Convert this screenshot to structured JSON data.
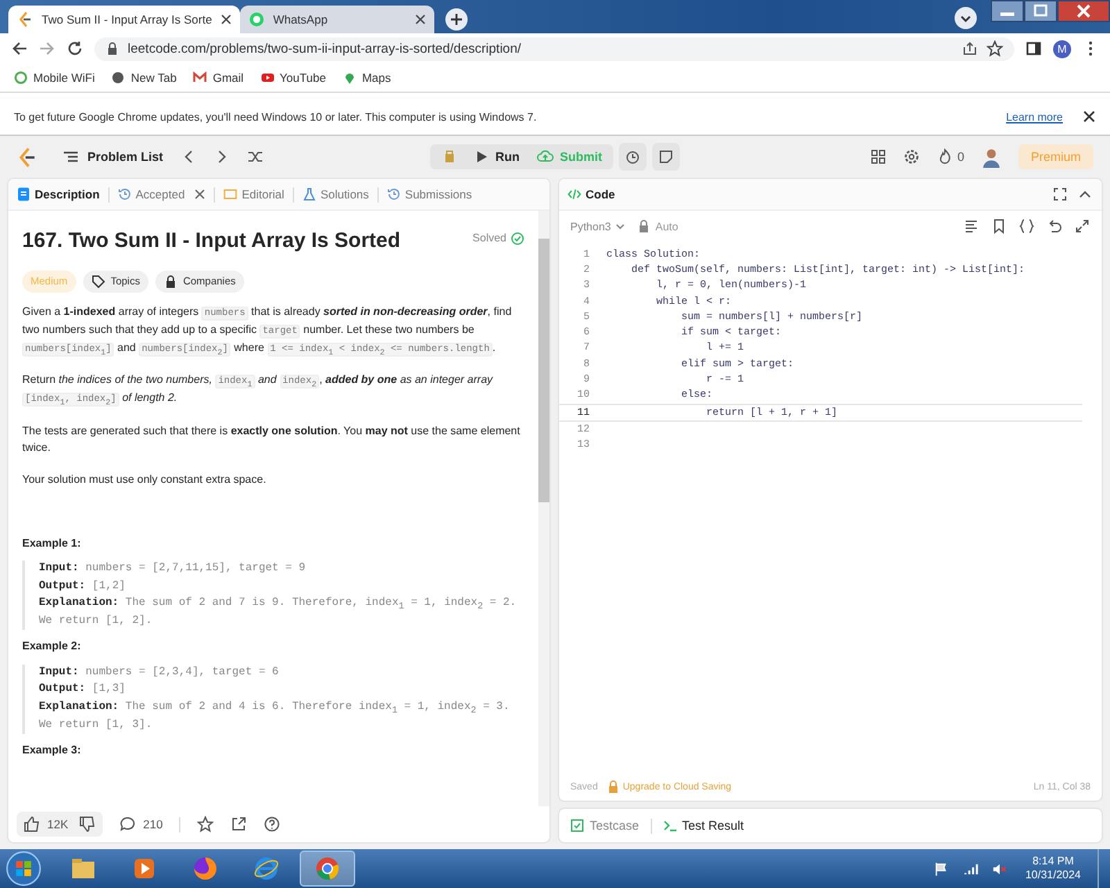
{
  "browser": {
    "tabs": [
      {
        "title": "Two Sum II - Input Array Is Sorte",
        "kind": "leetcode",
        "selected": true
      },
      {
        "title": "WhatsApp",
        "kind": "whatsapp",
        "selected": false
      }
    ],
    "url": "leetcode.com/problems/two-sum-ii-input-array-is-sorted/description/",
    "profile_initial": "M",
    "bookmarks": [
      {
        "label": "Mobile WiFi",
        "kind": "wifi"
      },
      {
        "label": "New Tab",
        "kind": "globe"
      },
      {
        "label": "Gmail",
        "kind": "gmail"
      },
      {
        "label": "YouTube",
        "kind": "youtube"
      },
      {
        "label": "Maps",
        "kind": "maps"
      }
    ]
  },
  "infobar": {
    "message": "To get future Google Chrome updates, you'll need Windows 10 or later. This computer is using Windows 7.",
    "link": "Learn more"
  },
  "header": {
    "problem_list": "Problem List",
    "run": "Run",
    "submit": "Submit",
    "streak": "0",
    "premium": "Premium"
  },
  "description_tabs": [
    {
      "label": "Description",
      "kind": "doc",
      "selected": true,
      "closable": false
    },
    {
      "label": "Accepted",
      "kind": "history",
      "selected": false,
      "closable": true
    },
    {
      "label": "Editorial",
      "kind": "book",
      "selected": false,
      "closable": false
    },
    {
      "label": "Solutions",
      "kind": "flask",
      "selected": false,
      "closable": false
    },
    {
      "label": "Submissions",
      "kind": "history",
      "selected": false,
      "closable": false
    }
  ],
  "problem": {
    "title": "167. Two Sum II - Input Array Is Sorted",
    "status": "Solved",
    "difficulty": "Medium",
    "topics": "Topics",
    "companies": "Companies",
    "paragraphs": [
      [
        {
          "kind": "text",
          "text": "Given a **1-indexed** array of integers "
        },
        {
          "kind": "code",
          "text": "numbers"
        },
        {
          "kind": "text",
          "text": " that is already "
        },
        {
          "kind": "strong-em",
          "text": "sorted in non-decreasing order"
        },
        {
          "kind": "text",
          "text": ", find two numbers such that they add up to a specific "
        },
        {
          "kind": "code",
          "text": "target"
        },
        {
          "kind": "text",
          "text": " number. Let these two numbers be "
        },
        {
          "kind": "code",
          "text": "numbers[index$_{1}$]"
        },
        {
          "kind": "text",
          "text": " and "
        },
        {
          "kind": "code",
          "text": "numbers[index$_{2}$]"
        },
        {
          "kind": "text",
          "text": " where "
        },
        {
          "kind": "code",
          "text": "1 <= index$_{1}$ < index$_{2}$ <= numbers.length"
        },
        {
          "kind": "text",
          "text": "."
        }
      ],
      [
        {
          "kind": "text",
          "text": "Return *the indices of the two numbers,* "
        },
        {
          "kind": "code",
          "text": "index$_{1}$"
        },
        {
          "kind": "text",
          "text": " *and* "
        },
        {
          "kind": "code",
          "text": "index$_{2}$"
        },
        {
          "kind": "text",
          "text": ", "
        },
        {
          "kind": "strong-em",
          "text": "added by one"
        },
        {
          "kind": "text",
          "text": " *as an integer array* "
        },
        {
          "kind": "code",
          "text": "[index$_{1}$, index$_{2}$]"
        },
        {
          "kind": "text",
          "text": " *of length 2.*"
        }
      ],
      [
        {
          "kind": "text",
          "text": "The tests are generated such that there is **exactly one solution**. You **may not** use the same element twice."
        }
      ],
      [
        {
          "kind": "text",
          "text": "Your solution must use only constant extra space."
        }
      ]
    ],
    "examples": [
      {
        "title": "Example 1:",
        "lines": [
          {
            "label": "Input:",
            "value": "numbers = [2,7,11,15], target = 9"
          },
          {
            "label": "Output:",
            "value": "[1,2]"
          },
          {
            "label": "Explanation:",
            "value": "The sum of 2 and 7 is 9. Therefore, index$_{1}$ = 1, index$_{2}$ = 2. We return [1, 2]."
          }
        ]
      },
      {
        "title": "Example 2:",
        "lines": [
          {
            "label": "Input:",
            "value": "numbers = [2,3,4], target = 6"
          },
          {
            "label": "Output:",
            "value": "[1,3]"
          },
          {
            "label": "Explanation:",
            "value": "The sum of 2 and 4 is 6. Therefore index$_{1}$ = 1, index$_{2}$ = 3. We return [1, 3]."
          }
        ]
      },
      {
        "title": "Example 3:"
      }
    ]
  },
  "left_footer": {
    "likes": "12K",
    "comments": "210"
  },
  "code_panel": {
    "title": "Code",
    "language": "Python3",
    "mode": "Auto",
    "lines": [
      {
        "number": "1",
        "text": "class Solution:",
        "current": false
      },
      {
        "number": "2",
        "text": "    def twoSum(self, numbers: List[int], target: int) -> List[int]:",
        "current": false
      },
      {
        "number": "3",
        "text": "        l, r = 0, len(numbers)-1",
        "current": false
      },
      {
        "number": "4",
        "text": "        while l < r:",
        "current": false
      },
      {
        "number": "5",
        "text": "            sum = numbers[l] + numbers[r]",
        "current": false
      },
      {
        "number": "6",
        "text": "            if sum < target:",
        "current": false
      },
      {
        "number": "7",
        "text": "                l += 1",
        "current": false
      },
      {
        "number": "8",
        "text": "            elif sum > target:",
        "current": false
      },
      {
        "number": "9",
        "text": "                r -= 1",
        "current": false
      },
      {
        "number": "10",
        "text": "            else:",
        "current": false
      },
      {
        "number": "11",
        "text": "                return [l + 1, r + 1]",
        "current": true
      },
      {
        "number": "12",
        "current": false
      },
      {
        "number": "13",
        "current": false
      }
    ],
    "saved": "Saved",
    "upgrade": "Upgrade to Cloud Saving",
    "cursor": "Ln 11, Col 38"
  },
  "bottom_tabs": [
    {
      "label": "Testcase",
      "kind": "check",
      "selected": false
    },
    {
      "label": "Test Result",
      "kind": "terminal",
      "selected": true
    }
  ],
  "taskbar": {
    "apps": [
      {
        "kind": "folder",
        "selected": false
      },
      {
        "kind": "media",
        "selected": false
      },
      {
        "kind": "firefox",
        "selected": false
      },
      {
        "kind": "ie",
        "selected": false
      },
      {
        "kind": "chrome",
        "selected": true
      }
    ],
    "time": "8:14 PM",
    "date": "10/31/2024"
  }
}
